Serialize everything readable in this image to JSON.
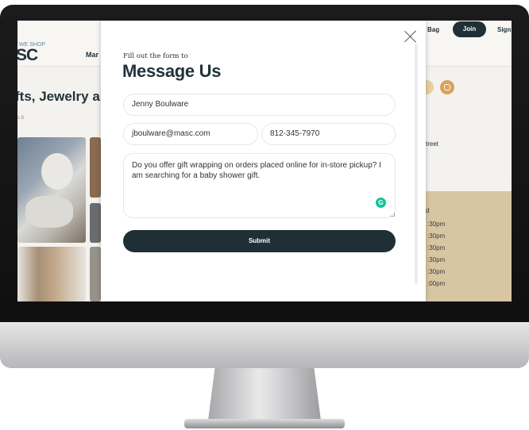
{
  "site": {
    "logo_small": "WE SHOP",
    "logo": "SC",
    "nav_item": "Mar",
    "header_bag": "Bag",
    "header_join": "Join",
    "header_sign": "Sign",
    "page_heading": "fts, Jewelry a",
    "breadcrumb": "s 8",
    "street_fragment": "treet",
    "hours_heading": "d",
    "hours": [
      ":30pm",
      ":30pm",
      ":30pm",
      ":30pm",
      ":30pm",
      ":00pm"
    ]
  },
  "modal": {
    "subtitle": "Fill out the form to",
    "title": "Message Us",
    "name_value": "Jenny Boulware",
    "email_value": "jboulware@masc.com",
    "phone_value": "812-345-7970",
    "message_value": "Do you offer gift wrapping on orders placed online for in-store pickup? I am searching for a baby shower gift.",
    "grammarly_glyph": "G",
    "submit_label": "Submit"
  },
  "colors": {
    "brand_dark": "#1f2f36",
    "hours_panel": "#d8c6a2",
    "grammarly": "#15c39a"
  },
  "icons": [
    "close-icon",
    "grammarly-icon",
    "instagram-icon",
    "resize-handle-icon"
  ]
}
